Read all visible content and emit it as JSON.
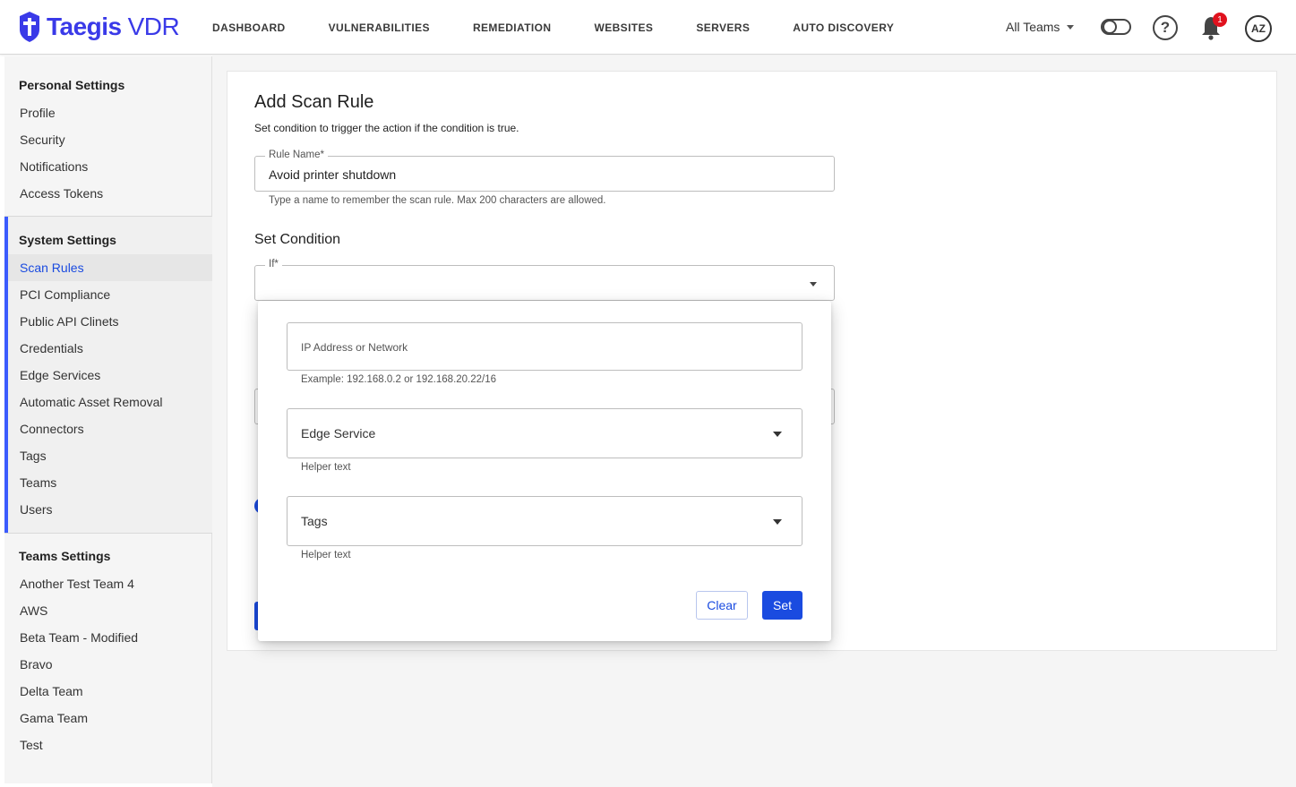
{
  "header": {
    "logo_brand": "Taegis",
    "logo_product": "VDR",
    "nav": [
      "DASHBOARD",
      "VULNERABILITIES",
      "REMEDIATION",
      "WEBSITES",
      "SERVERS",
      "AUTO DISCOVERY"
    ],
    "team_selector": "All Teams",
    "help_glyph": "?",
    "notification_count": "1",
    "avatar_initials": "AZ",
    "icons": [
      "taegis-logo-icon",
      "dark-mode-toggle",
      "help-icon",
      "bell-icon",
      "avatar"
    ]
  },
  "sidebar": {
    "personal": {
      "heading": "Personal Settings",
      "items": [
        "Profile",
        "Security",
        "Notifications",
        "Access Tokens"
      ]
    },
    "system": {
      "heading": "System Settings",
      "selected": "Scan Rules",
      "items": [
        "Scan Rules",
        "PCI Compliance",
        "Public API Clinets",
        "Credentials",
        "Edge Services",
        "Automatic Asset Removal",
        "Connectors",
        "Tags",
        "Teams",
        "Users"
      ]
    },
    "teams": {
      "heading": "Teams Settings",
      "items": [
        "Another Test Team 4",
        "AWS",
        "Beta Team - Modified",
        "Bravo",
        "Delta Team",
        "Gama Team",
        "Test"
      ]
    }
  },
  "form": {
    "title": "Add Scan Rule",
    "subtitle": "Set condition to trigger the action if the condition is true.",
    "rule_name_label": "Rule Name*",
    "rule_name_value": "Avoid printer shutdown",
    "rule_name_helper": "Type a name to remember the scan rule. Max 200 characters are allowed.",
    "condition_title": "Set Condition",
    "if_label": "If*",
    "if_value": ""
  },
  "condition_popover": {
    "ip_placeholder": "IP Address or Network",
    "ip_helper": "Example: 192.168.0.2 or 192.168.20.22/16",
    "edge_service_value": "Edge Service",
    "edge_service_helper": "Helper text",
    "tags_value": "Tags",
    "tags_helper": "Helper text",
    "clear_label": "Clear",
    "set_label": "Set"
  },
  "colors": {
    "brand": "#3a3ae8",
    "accent": "#1a4be0",
    "badge": "#e0121e"
  }
}
